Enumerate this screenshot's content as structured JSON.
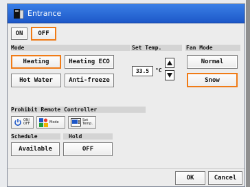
{
  "window": {
    "title": "Entrance"
  },
  "power": {
    "on_label": "ON",
    "off_label": "OFF",
    "selected": "OFF"
  },
  "mode": {
    "label": "Mode",
    "options": [
      "Heating",
      "Heating ECO",
      "Hot Water",
      "Anti-freeze"
    ],
    "selected": "Heating"
  },
  "set_temp": {
    "label": "Set Temp.",
    "value": "33.5",
    "unit": "°C"
  },
  "fan_mode": {
    "label": "Fan Mode",
    "options": [
      "Normal",
      "Snow"
    ],
    "selected": "Snow"
  },
  "prohibit": {
    "label": "Prohibit Remote Controller",
    "buttons": [
      {
        "text1": "ON/",
        "text2": "OFF",
        "icon": "power-icon"
      },
      {
        "text1": "",
        "text2": "Mode",
        "icon": "mode-icon"
      },
      {
        "text1": "Set",
        "text2": "Temp.",
        "icon": "thermometer-icon"
      }
    ]
  },
  "schedule": {
    "label": "Schedule",
    "value": "Available"
  },
  "hold": {
    "label": "Hold",
    "value": "OFF"
  },
  "footer": {
    "ok_label": "OK",
    "cancel_label": "Cancel"
  },
  "colors": {
    "title_bar": "#2a6cdc",
    "selected_border": "#f07b16",
    "background": "#ececec"
  }
}
